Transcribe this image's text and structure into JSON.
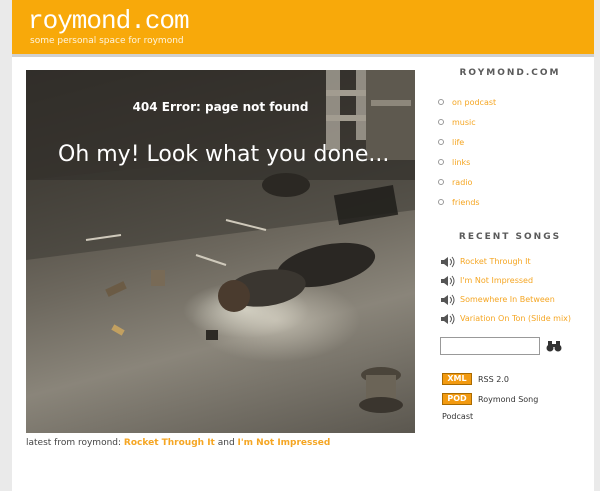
{
  "header": {
    "title": "roymond.com",
    "tagline": "some personal space for roymond"
  },
  "hero": {
    "error_text": "404 Error: page not found",
    "headline": "Oh my! Look what you done..."
  },
  "latest": {
    "prefix": "latest from roymond:",
    "link1": "Rocket Through It",
    "joiner": "and",
    "link2": "I'm Not Impressed"
  },
  "sidebar": {
    "nav_heading": "ROYMOND.COM",
    "nav_items": [
      "on podcast",
      "music",
      "life",
      "links",
      "radio",
      "friends"
    ],
    "songs_heading": "RECENT SONGS",
    "songs": [
      "Rocket Through It",
      "I'm Not Impressed",
      "Somewhere In Between",
      "Variation On Ton (Slide mix)"
    ],
    "search_placeholder": "",
    "feeds": {
      "xml_badge": "XML",
      "xml_label": "RSS 2.0",
      "pod_badge": "POD",
      "pod_label": "Roymond Song",
      "pod_label_2": "Podcast"
    }
  },
  "colors": {
    "accent": "#f8a90a",
    "link": "#f5a623"
  },
  "icons": [
    "speaker-icon",
    "binoculars-icon"
  ]
}
